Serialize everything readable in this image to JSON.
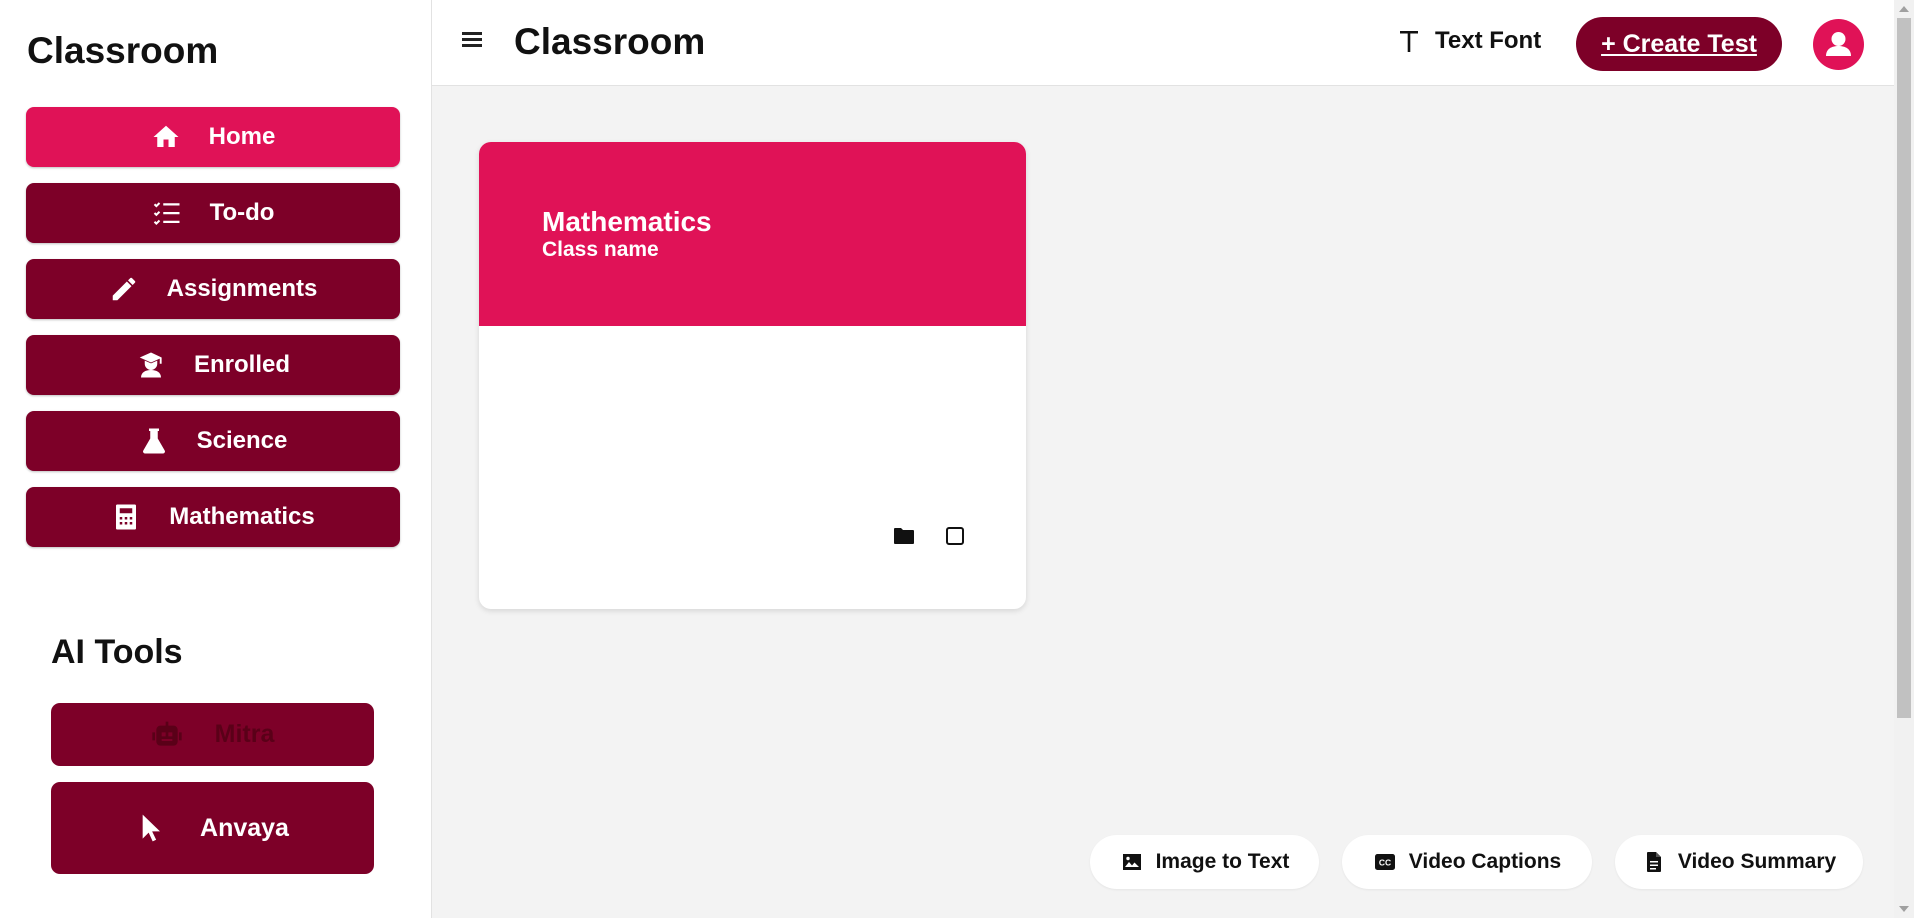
{
  "sidebar": {
    "brand": "Classroom",
    "items": [
      {
        "label": "Home",
        "icon": "home-icon",
        "active": true
      },
      {
        "label": "To-do",
        "icon": "checklist-icon"
      },
      {
        "label": "Assignments",
        "icon": "pencil-icon"
      },
      {
        "label": "Enrolled",
        "icon": "graduate-icon"
      },
      {
        "label": "Science",
        "icon": "flask-icon"
      },
      {
        "label": "Mathematics",
        "icon": "calculator-icon"
      }
    ],
    "ai_title": "AI Tools",
    "ai_items": [
      {
        "label": "Mitra",
        "icon": "robot-icon",
        "disabled": true
      },
      {
        "label": "Anvaya",
        "icon": "cursor-icon"
      }
    ]
  },
  "header": {
    "title": "Classroom",
    "text_font_label": "Text Font",
    "create_label": "+ Create Test"
  },
  "card": {
    "title": "Mathematics",
    "subtitle": "Class name"
  },
  "tools": [
    {
      "label": "Image to Text",
      "icon": "image-icon"
    },
    {
      "label": "Video Captions",
      "icon": "closed-captions-icon"
    },
    {
      "label": "Video Summary",
      "icon": "document-icon"
    }
  ],
  "colors": {
    "accent": "#e01257",
    "dark": "#7d0028",
    "background": "#f3f3f3"
  }
}
